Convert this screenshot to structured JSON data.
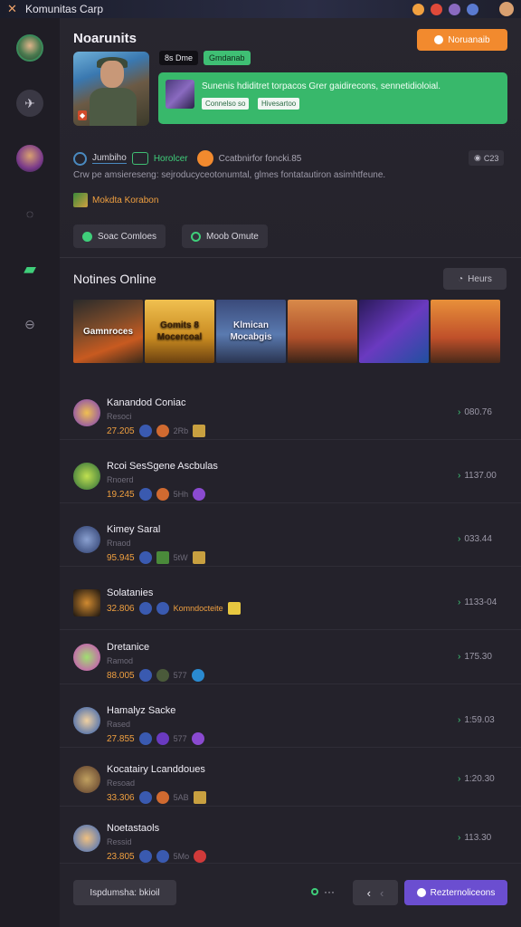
{
  "app": {
    "title": "Komunitas Carp"
  },
  "colors": {
    "accent_orange": "#f28a2e",
    "accent_green": "#3fce7a",
    "accent_purple": "#6b4ed0"
  },
  "sidebar": {
    "icons": [
      "avatar",
      "plane-icon",
      "avatar",
      "chat-icon",
      "document-icon",
      "lock-icon"
    ]
  },
  "header": {
    "title": "Noarunits",
    "action_label": "Noruanaib",
    "pill_dark": "8s Dme",
    "pill_green": "Gmdanab",
    "card_text": "Sunenis hdiditret torpacos Grer gaidirecons, sennetidioloial.",
    "card_tags": [
      "Connelso so",
      "Hivesartoo"
    ],
    "meta_label": "Jumbiho",
    "meta_green": "Horolcer",
    "meta_grey": "Ccatbnirfor foncki.85",
    "count": "C23",
    "description": "Crw pe amsiereseng: sejroducyceotonumtal, glmes fontatautiron asimhtfeune.",
    "link_text": "Mokdta Korabon",
    "button_1": "Soac Comloes",
    "button_2": "Moob Omute"
  },
  "online": {
    "title": "Notines Online",
    "hours_label": "Heurs",
    "thumbs": [
      {
        "label": "Gamnroces"
      },
      {
        "label": "Gomits 8 Mocercoal"
      },
      {
        "label": "Klmican Mocabgis"
      },
      {
        "label": ""
      },
      {
        "label": ""
      },
      {
        "label": ""
      }
    ]
  },
  "players": [
    {
      "name": "Kanandod Coniac",
      "sub": "Resoci",
      "score": "27.205",
      "small": "2Rb",
      "value": "080.76"
    },
    {
      "name": "Rcoi SesSgene Ascbulas",
      "sub": "Rnoerd",
      "score": "19.245",
      "small": "5Hh",
      "value": "1137.00"
    },
    {
      "name": "Kimey Saral",
      "sub": "Rnaod",
      "score": "95.945",
      "small": "5tW",
      "value": "033.44"
    },
    {
      "name": "Solatanies",
      "sub": "",
      "score": "32.806",
      "small": "Komndocteite",
      "value": "1133-04"
    },
    {
      "name": "Dretanice",
      "sub": "Ramod",
      "score": "88.005",
      "small": "577",
      "value": "175.30"
    },
    {
      "name": "Hamalyz Sacke",
      "sub": "Rased",
      "score": "27.855",
      "small": "577",
      "value": "1:59.03"
    },
    {
      "name": "Kocatairy Lcanddoues",
      "sub": "Resoad",
      "score": "33.306",
      "small": "5AB",
      "value": "1:20.30"
    },
    {
      "name": "Noetastaols",
      "sub": "Ressid",
      "score": "23.805",
      "small": "5Mo",
      "value": "113.30"
    }
  ],
  "footer": {
    "left_label": "Ispdumsha: bkioil",
    "dots": "···",
    "primary_label": "Rezternoliceons"
  }
}
